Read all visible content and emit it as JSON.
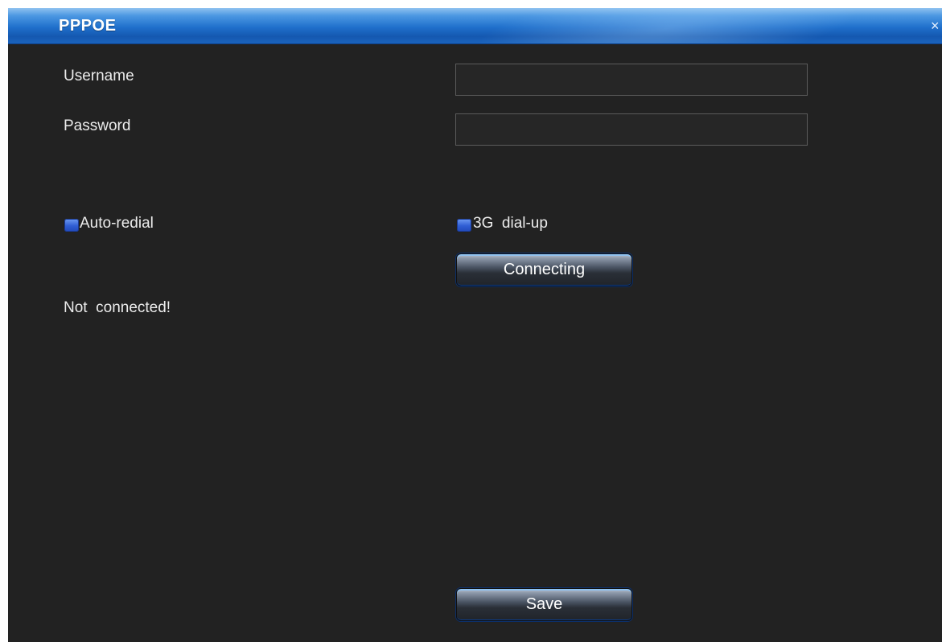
{
  "window": {
    "title": "PPPOE",
    "close_glyph": "×"
  },
  "form": {
    "username_label": "Username",
    "username_value": "",
    "password_label": "Password",
    "password_value": "",
    "auto_redial_label": "Auto-redial",
    "auto_redial_checked": true,
    "dialup_3g_label": "3G  dial-up",
    "dialup_3g_checked": true,
    "connect_button_label": "Connecting",
    "status_text": "Not  connected!",
    "save_button_label": "Save"
  },
  "colors": {
    "titlebar_accent": "#1f6fcb",
    "panel_background": "#222222",
    "checkbox_fill": "#2f5ed4"
  }
}
